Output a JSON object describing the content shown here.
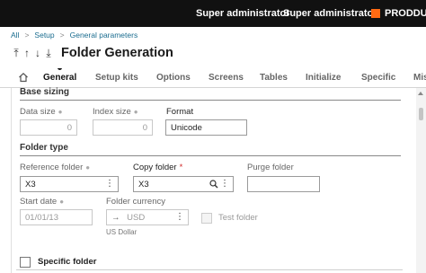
{
  "topbar": {
    "user1": "Super administrator",
    "user2": "Super administrator",
    "folder": "PRODDUM",
    "accent": "#ff6a13"
  },
  "breadcrumb": [
    "All",
    "Setup",
    "General parameters"
  ],
  "header": {
    "title": "Folder Generation",
    "nav_icons": [
      "pin-icon",
      "arrow-up-icon",
      "arrow-down-icon",
      "download-icon"
    ]
  },
  "tabs": [
    {
      "label": "General",
      "active": true
    },
    {
      "label": "Setup kits"
    },
    {
      "label": "Options"
    },
    {
      "label": "Screens"
    },
    {
      "label": "Tables"
    },
    {
      "label": "Initialize"
    },
    {
      "label": "Specific"
    },
    {
      "label": "Mis"
    }
  ],
  "base_sizing": {
    "title": "Base sizing",
    "data_size": {
      "label": "Data size",
      "value": "0"
    },
    "index_size": {
      "label": "Index size",
      "value": "0"
    },
    "format": {
      "label": "Format",
      "value": "Unicode"
    }
  },
  "folder_type": {
    "title": "Folder type",
    "reference_folder": {
      "label": "Reference folder",
      "value": "X3"
    },
    "copy_folder": {
      "label": "Copy folder",
      "value": "X3"
    },
    "purge_folder": {
      "label": "Purge folder",
      "value": ""
    },
    "start_date": {
      "label": "Start date",
      "value": "01/01/13"
    },
    "folder_currency": {
      "label": "Folder currency",
      "value": "USD",
      "sub": "US Dollar"
    },
    "test_folder": {
      "label": "Test folder",
      "checked": false
    }
  },
  "specific_folder": {
    "label": "Specific folder",
    "checked": false
  }
}
